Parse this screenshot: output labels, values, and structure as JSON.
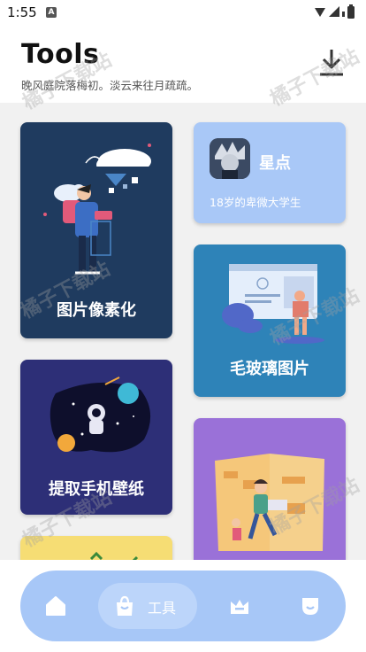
{
  "status": {
    "time": "1:55",
    "notif_letter": "A"
  },
  "header": {
    "title": "Tools",
    "subtitle": "晚风庭院落梅初。淡云来往月疏疏。"
  },
  "cards": {
    "pixelate": {
      "label": "图片像素化"
    },
    "profile": {
      "name": "星点",
      "desc": "18岁的卑微大学生"
    },
    "frosted": {
      "label": "毛玻璃图片"
    },
    "wallpaper": {
      "label": "提取手机壁纸"
    }
  },
  "watermark": "橘子下载站",
  "nav": {
    "items": [
      {
        "icon": "home-icon"
      },
      {
        "icon": "shopping-bag-icon",
        "label": "工具",
        "active": true
      },
      {
        "icon": "crown-icon"
      },
      {
        "icon": "emoji-icon"
      }
    ]
  },
  "colors": {
    "nav_bg": "#a7c7f7",
    "nav_active": "#bcd5fa",
    "card_pixelate": "#1f3b5f",
    "card_profile": "#a9c8f7",
    "card_frosted": "#2e83b8",
    "card_wallpaper": "#2d2f77",
    "card_reading": "#9a71d8",
    "card_partial": "#f6dd74"
  }
}
